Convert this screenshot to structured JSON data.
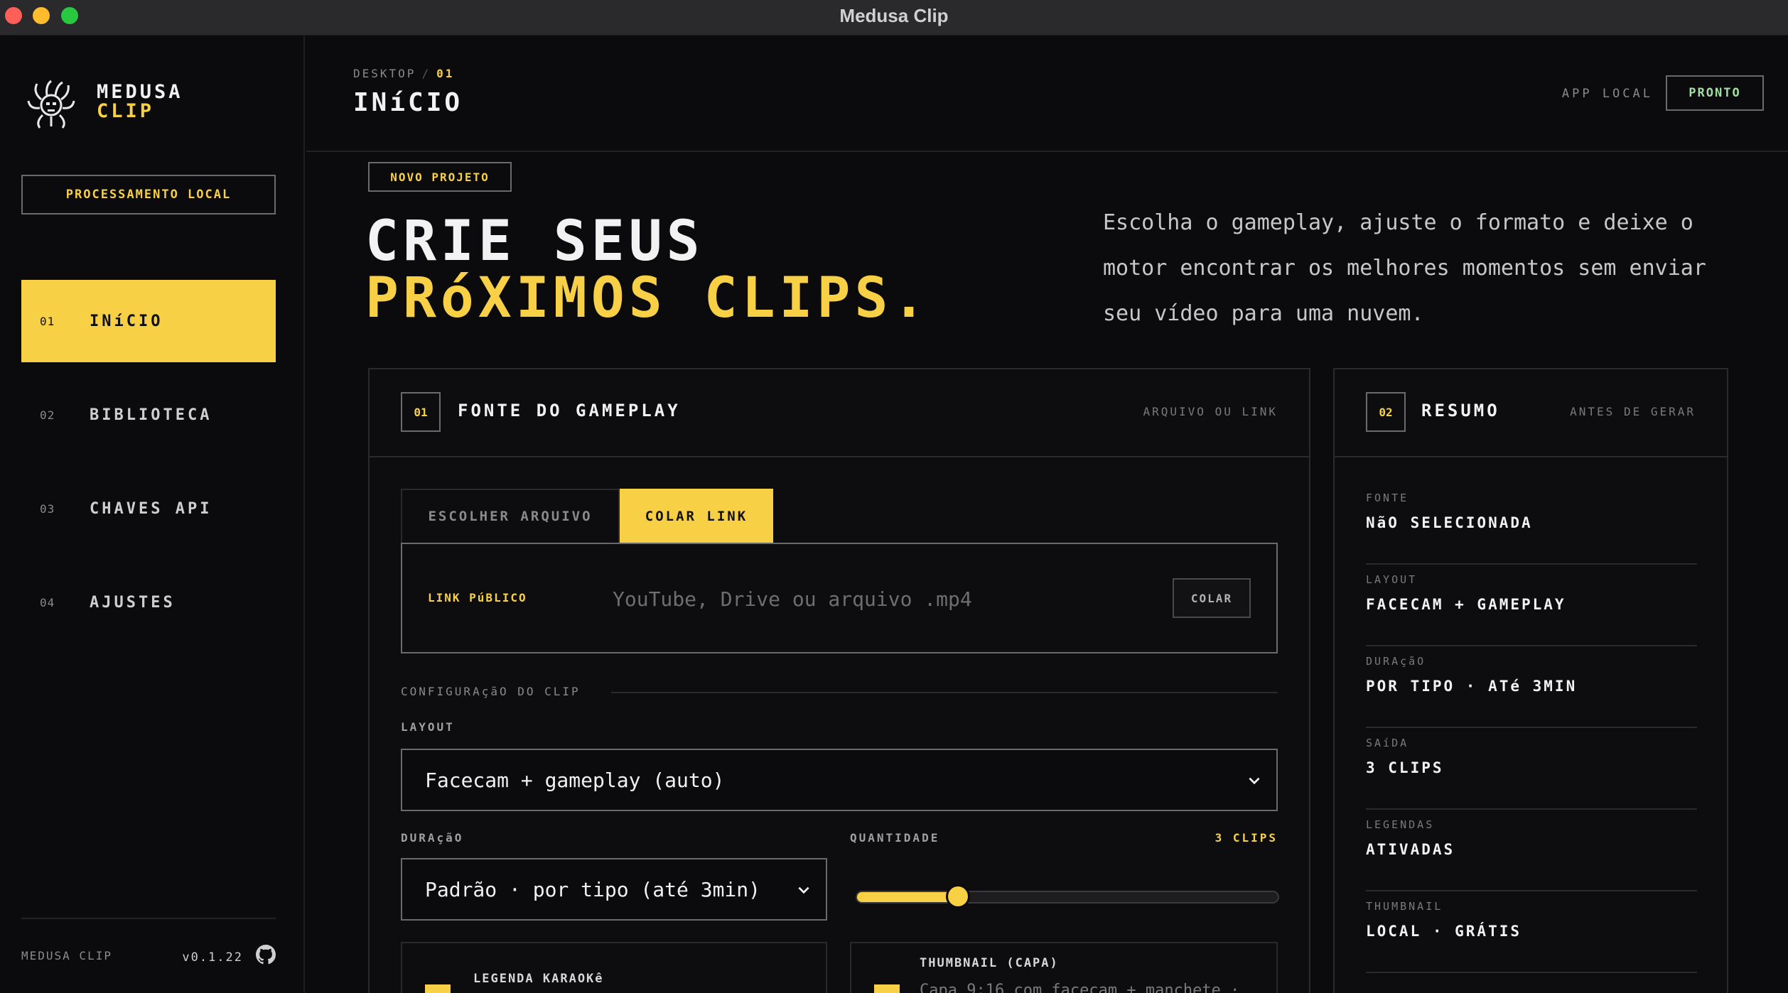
{
  "window": {
    "title": "Medusa Clip"
  },
  "sidebar": {
    "logo_line1": "MEDUSA",
    "logo_line2": "CLIP",
    "local_badge": "PROCESSAMENTO LOCAL",
    "items": [
      {
        "num": "01",
        "label": "INíCIO",
        "active": true
      },
      {
        "num": "02",
        "label": "BIBLIOTECA",
        "active": false
      },
      {
        "num": "03",
        "label": "CHAVES API",
        "active": false
      },
      {
        "num": "04",
        "label": "AJUSTES",
        "active": false
      }
    ],
    "footer_name": "MEDUSA CLIP",
    "footer_version": "v0.1.22",
    "footer_icon": "github-icon"
  },
  "header": {
    "crumb_root": "DESKTOP",
    "crumb_sep": "/",
    "crumb_current": "01",
    "title": "INíCIO",
    "app_local": "APP LOCAL",
    "status": "PRONTO"
  },
  "hero": {
    "badge": "NOVO PROJETO",
    "title_line1": "CRIE SEUS",
    "title_line2": "PRóXIMOS CLIPS.",
    "description": "Escolha o gameplay, ajuste o formato e deixe o motor encontrar os melhores momentos sem enviar seu vídeo para uma nuvem."
  },
  "source_panel": {
    "num": "01",
    "title": "FONTE DO GAMEPLAY",
    "aside": "ARQUIVO OU LINK",
    "tab_file": "ESCOLHER ARQUIVO",
    "tab_link": "COLAR LINK",
    "link_label": "LINK PúBLICO",
    "link_placeholder": "YouTube, Drive ou arquivo .mp4",
    "link_value": "",
    "paste_button": "COLAR",
    "config_label": "CONFIGURAçãO DO CLIP",
    "layout_label": "LAYOUT",
    "layout_value": "Facecam + gameplay (auto)",
    "duration_label": "DURAçãO",
    "duration_value": "Padrão · por tipo (até 3min)",
    "quantity_label": "QUANTIDADE",
    "quantity_count": "3 CLIPS",
    "quantity_fraction": 0.24,
    "karaoke_title": "LEGENDA KARAOKê",
    "thumbnail_title": "THUMBNAIL (CAPA)",
    "thumbnail_desc": "Capa 9:16 com facecam + manchete ·"
  },
  "summary_panel": {
    "num": "02",
    "title": "RESUMO",
    "aside": "ANTES DE GERAR",
    "rows": [
      {
        "key": "FONTE",
        "value": "NãO SELECIONADA"
      },
      {
        "key": "LAYOUT",
        "value": "FACECAM + GAMEPLAY"
      },
      {
        "key": "DURAçãO",
        "value": "POR TIPO · ATé 3MIN"
      },
      {
        "key": "SAíDA",
        "value": "3 CLIPS"
      },
      {
        "key": "LEGENDAS",
        "value": "ATIVADAS"
      },
      {
        "key": "THUMBNAIL",
        "value": "LOCAL · GRÁTIS"
      }
    ]
  },
  "colors": {
    "accent": "#f7d046",
    "background": "#0b0b0d",
    "ready": "#9fe0a0"
  }
}
